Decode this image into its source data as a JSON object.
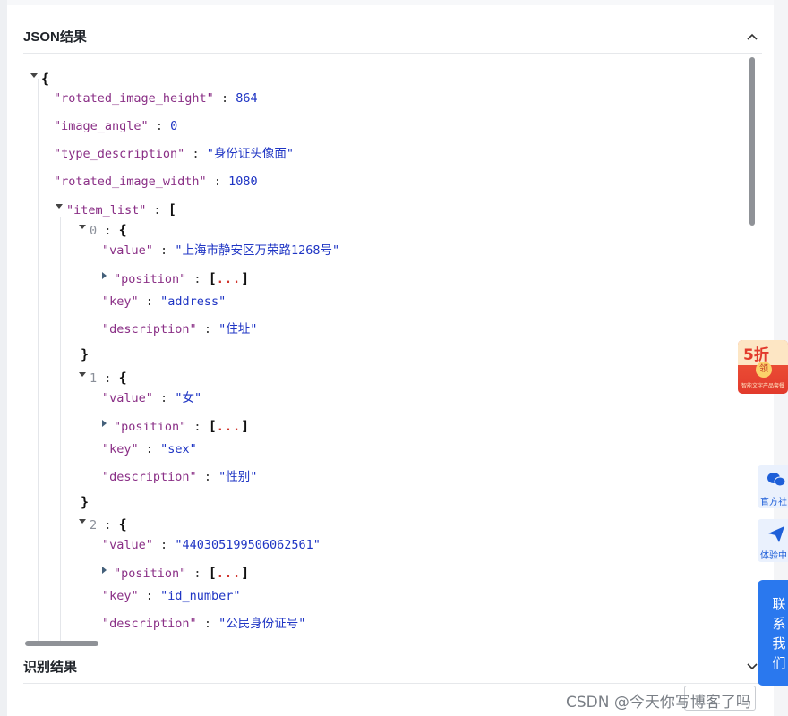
{
  "panel": {
    "json_title": "JSON结果",
    "result_title": "识别结果"
  },
  "json": {
    "open_brace": "{",
    "rotated_image_height": {
      "key": "\"rotated_image_height\"",
      "value": "864"
    },
    "image_angle": {
      "key": "\"image_angle\"",
      "value": "0"
    },
    "type_description": {
      "key": "\"type_description\"",
      "value": "\"身份证头像面\""
    },
    "rotated_image_width": {
      "key": "\"rotated_image_width\"",
      "value": "1080"
    },
    "item_list_key": "\"item_list\"",
    "items": [
      {
        "index": "0",
        "value": "\"上海市静安区万荣路1268号\"",
        "key_value": "\"address\"",
        "description": "\"住址\""
      },
      {
        "index": "1",
        "value": "\"女\"",
        "key_value": "\"sex\"",
        "description": "\"性别\""
      },
      {
        "index": "2",
        "value": "\"440305199506062561\"",
        "key_value": "\"id_number\"",
        "description": "\"公民身份证号\""
      }
    ],
    "labels": {
      "value": "\"value\"",
      "position": "\"position\"",
      "key": "\"key\"",
      "description": "\"description\"",
      "ellipsis": "...",
      "colon": ":",
      "open_bracket": "[",
      "close_bracket": "]",
      "open_brace": "{",
      "close_brace": "}"
    }
  },
  "sidebar": {
    "promo_text": "5折",
    "promo_coin": "领",
    "promo_sub": "智能文字产品套餐",
    "wechat_label": "官方社",
    "trial_label": "体验中",
    "contact_label": "联系我们"
  },
  "watermark": "CSDN @今天你写博客了吗",
  "colors": {
    "accent": "#2a78ee",
    "json_key": "#8a2f86",
    "json_value": "#1f35c4",
    "ellipsis": "#d0342c"
  },
  "icons": [
    "chevron-up-icon",
    "chevron-down-icon",
    "wechat-icon",
    "paper-plane-icon",
    "coupon-icon"
  ]
}
